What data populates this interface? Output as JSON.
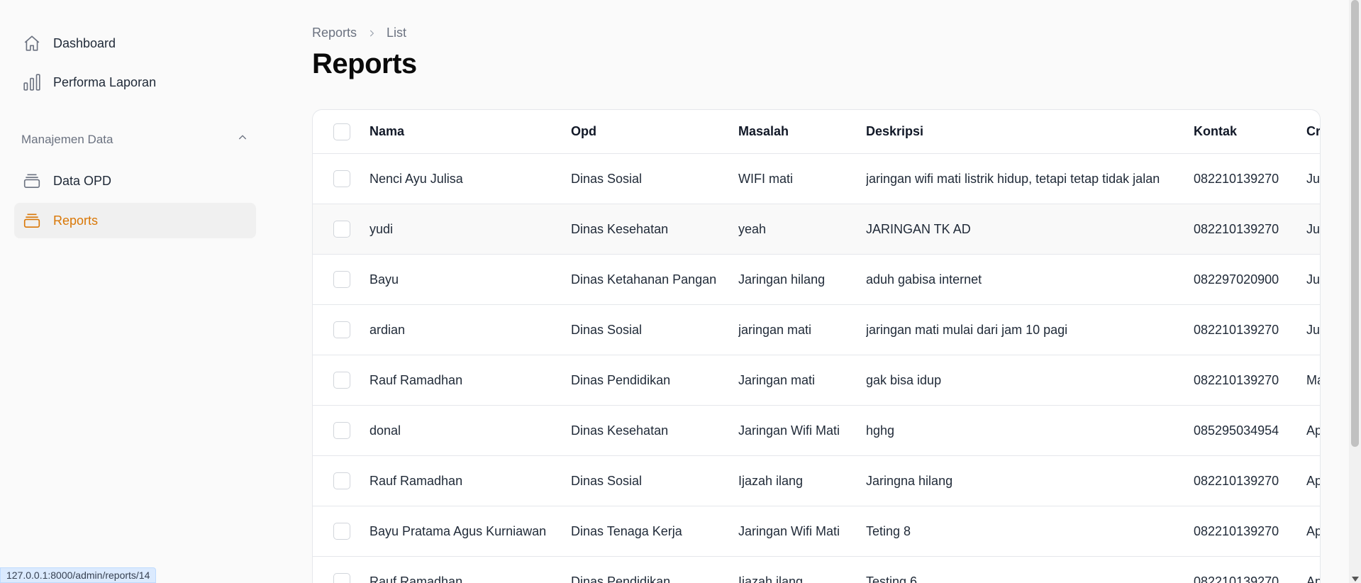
{
  "sidebar": {
    "items": [
      {
        "label": "Dashboard",
        "icon": "home-icon"
      },
      {
        "label": "Performa Laporan",
        "icon": "bar-chart-icon"
      }
    ],
    "group": {
      "label": "Manajemen Data",
      "items": [
        {
          "label": "Data OPD",
          "icon": "stack-icon"
        },
        {
          "label": "Reports",
          "icon": "stack-icon",
          "active": true
        }
      ]
    }
  },
  "breadcrumb": {
    "items": [
      "Reports",
      "List"
    ]
  },
  "page": {
    "title": "Reports"
  },
  "table": {
    "columns": [
      "Nama",
      "Opd",
      "Masalah",
      "Deskripsi",
      "Kontak",
      "Cr"
    ],
    "rows": [
      {
        "nama": "Nenci Ayu Julisa",
        "opd": "Dinas Sosial",
        "masalah": "WIFI mati",
        "deskripsi": "jaringan wifi mati listrik hidup, tetapi tetap tidak jalan",
        "kontak": "082210139270",
        "created": "Ju"
      },
      {
        "nama": "yudi",
        "opd": "Dinas Kesehatan",
        "masalah": "yeah",
        "deskripsi": "JARINGAN TK AD",
        "kontak": "082210139270",
        "created": "Ju"
      },
      {
        "nama": "Bayu",
        "opd": "Dinas Ketahanan Pangan",
        "masalah": "Jaringan hilang",
        "deskripsi": "aduh gabisa internet",
        "kontak": "082297020900",
        "created": "Ju"
      },
      {
        "nama": "ardian",
        "opd": "Dinas Sosial",
        "masalah": "jaringan mati",
        "deskripsi": "jaringan mati mulai dari jam 10 pagi",
        "kontak": "082210139270",
        "created": "Ju"
      },
      {
        "nama": "Rauf Ramadhan",
        "opd": "Dinas Pendidikan",
        "masalah": "Jaringan mati",
        "deskripsi": "gak bisa idup",
        "kontak": "082210139270",
        "created": "Ma"
      },
      {
        "nama": "donal",
        "opd": "Dinas Kesehatan",
        "masalah": "Jaringan Wifi Mati",
        "deskripsi": "hghg",
        "kontak": "085295034954",
        "created": "Ap"
      },
      {
        "nama": "Rauf Ramadhan",
        "opd": "Dinas Sosial",
        "masalah": "Ijazah ilang",
        "deskripsi": "Jaringna hilang",
        "kontak": "082210139270",
        "created": "Ap"
      },
      {
        "nama": "Bayu Pratama Agus Kurniawan",
        "opd": "Dinas Tenaga Kerja",
        "masalah": "Jaringan Wifi Mati",
        "deskripsi": "Teting 8",
        "kontak": "082210139270",
        "created": "Ap"
      },
      {
        "nama": "Rauf Ramadhan",
        "opd": "Dinas Pendidikan",
        "masalah": "Ijazah ilang",
        "deskripsi": "Testing 6",
        "kontak": "082210139270",
        "created": "Ap"
      }
    ]
  },
  "status_bar": {
    "url": "127.0.0.1:8000/admin/reports/14"
  },
  "colors": {
    "accent": "#d97706",
    "muted": "#6b7280",
    "border": "#e5e7eb"
  }
}
